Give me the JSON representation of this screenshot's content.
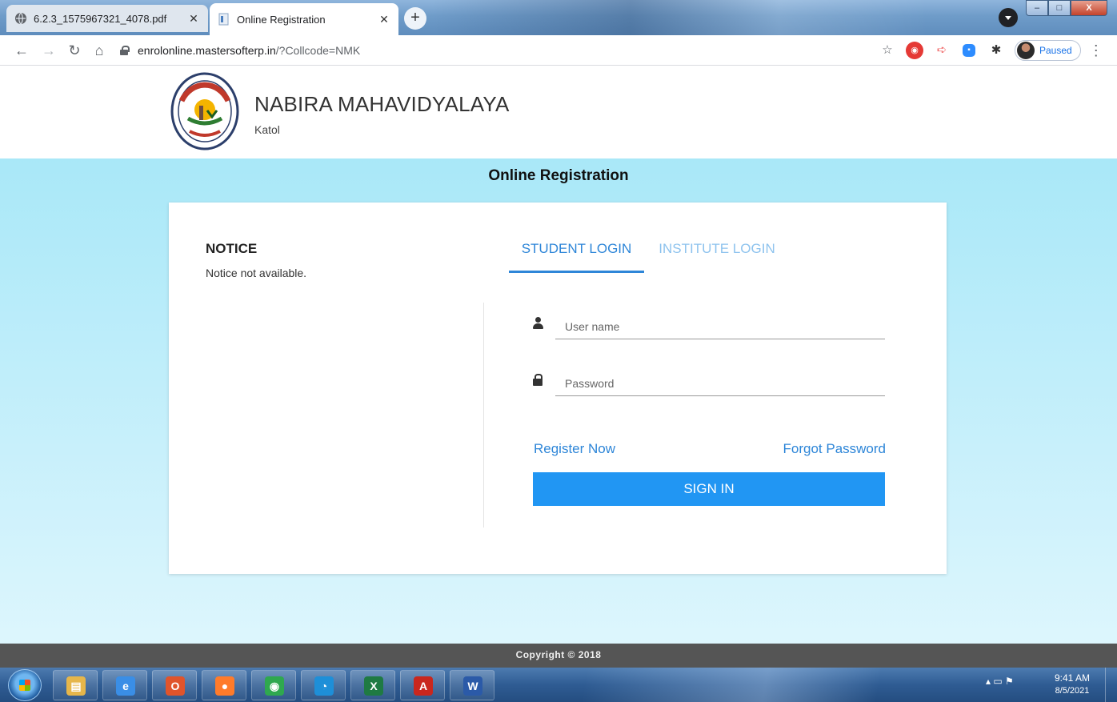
{
  "browser": {
    "tabs": [
      {
        "title": "6.2.3_1575967321_4078.pdf",
        "active": false
      },
      {
        "title": "Online Registration",
        "active": true
      }
    ],
    "new_tab": "+",
    "address": {
      "host": "enrolonline.mastersofterp.in",
      "path": "/?Collcode=NMK"
    },
    "profile_status": "Paused",
    "window_buttons": {
      "minimize": "–",
      "maximize": "□",
      "close": "X"
    }
  },
  "header": {
    "college_name": "NABIRA MAHAVIDYALAYA",
    "city": "Katol"
  },
  "page_title": "Online Registration",
  "notice": {
    "title": "NOTICE",
    "text": "Notice not available."
  },
  "login": {
    "tabs": {
      "student": "STUDENT LOGIN",
      "institute": "INSTITUTE LOGIN",
      "active": "student"
    },
    "username_placeholder": "User name",
    "password_placeholder": "Password",
    "register_link": "Register Now",
    "forgot_link": "Forgot Password",
    "signin_button": "SIGN IN"
  },
  "footer": {
    "copyright": "Copyright © 2018"
  },
  "taskbar": {
    "apps": [
      {
        "name": "file-explorer",
        "glyph": "▤",
        "color": "#e6b64a"
      },
      {
        "name": "internet-explorer",
        "glyph": "e",
        "color": "#3a8ee6"
      },
      {
        "name": "office",
        "glyph": "O",
        "color": "#e0542b"
      },
      {
        "name": "firefox",
        "glyph": "●",
        "color": "#ff7b2a"
      },
      {
        "name": "chrome",
        "glyph": "◉",
        "color": "#2fa84f"
      },
      {
        "name": "edge",
        "glyph": "◔",
        "color": "#1e8fd8"
      },
      {
        "name": "excel",
        "glyph": "X",
        "color": "#1f7a43"
      },
      {
        "name": "acrobat",
        "glyph": "A",
        "color": "#c9271e"
      },
      {
        "name": "word",
        "glyph": "W",
        "color": "#2b5aa8"
      }
    ],
    "tray_icons": "▴  ▭  ⚑",
    "time": "9:41 AM",
    "date": "8/5/2021"
  }
}
